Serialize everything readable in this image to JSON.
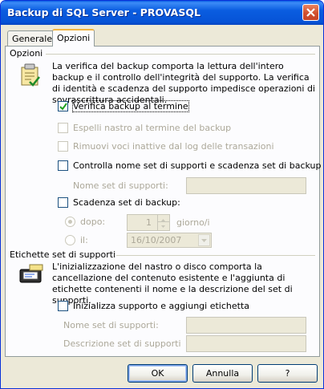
{
  "window": {
    "title": "Backup di SQL Server - PROVASQL"
  },
  "tabs": [
    {
      "label": "Generale"
    },
    {
      "label": "Opzioni"
    }
  ],
  "options_group": {
    "label": "Opzioni",
    "icon": "verify-backup-icon",
    "description": "La verifica del backup comporta la lettura dell'intero backup e il controllo dell'integrità del supporto. La verifica di identità e scadenza del supporto impedisce operazioni di sovrascrittura accidentali.",
    "verify_backup": {
      "label": "Verifica backup al termine",
      "checked": true,
      "enabled": true
    },
    "eject_tape": {
      "label": "Espelli nastro al termine del backup",
      "checked": false,
      "enabled": false
    },
    "remove_inactive": {
      "label": "Rimuovi voci inattive dal log delle transazioni",
      "checked": false,
      "enabled": false
    },
    "check_media_set": {
      "label": "Controlla nome set di supporti e scadenza set di backup",
      "checked": false,
      "enabled": true
    },
    "media_set_name": {
      "label": "Nome set di supporti:",
      "value": ""
    },
    "backup_set_expiry": {
      "label": "Scadenza set di backup:",
      "checked": false,
      "enabled": true
    },
    "after": {
      "label": "dopo:",
      "value": "1",
      "unit": "giorno/i",
      "selected": true
    },
    "on": {
      "label": "il:",
      "value": "16/10/2007",
      "selected": false
    }
  },
  "labels_group": {
    "label": "Etichette set di supporti",
    "icon": "tape-label-icon",
    "description": "L'inizializzazione del nastro o disco comporta la cancellazione del contenuto esistente e l'aggiunta di etichette contenenti il nome e la descrizione del set di supporti.",
    "init_media": {
      "label": "Inizializza supporto e aggiungi etichetta",
      "checked": false,
      "enabled": true
    },
    "media_name": {
      "label": "Nome set di supporti:",
      "value": ""
    },
    "media_description": {
      "label": "Descrizione set di supporti",
      "value": ""
    }
  },
  "buttons": {
    "ok": "OK",
    "cancel": "Annulla",
    "help": "?"
  },
  "colors": {
    "titlebar": "#0a5de0",
    "dialog_bg": "#ece9d8",
    "tab_highlight": "#f1b440",
    "disabled_text": "#aca899"
  }
}
